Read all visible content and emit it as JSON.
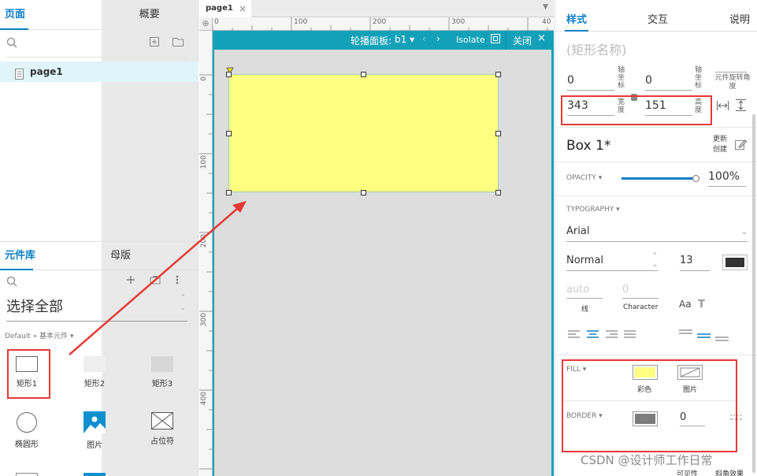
{
  "left": {
    "tabs": [
      "页面",
      "概要"
    ],
    "page": "page1",
    "lib_tabs": [
      "元件库",
      "母版"
    ],
    "select_all": "选择全部",
    "breadcrumb": "Default » 基本元件 ▾",
    "items": [
      {
        "label": "矩形1",
        "icon": "rect-outline-icon"
      },
      {
        "label": "矩形2",
        "icon": "rect-light-icon"
      },
      {
        "label": "矩形3",
        "icon": "rect-gray-icon"
      },
      {
        "label": "椭圆形",
        "icon": "ellipse-icon"
      },
      {
        "label": "图片",
        "icon": "image-icon"
      },
      {
        "label": "占位符",
        "icon": "placeholder-icon"
      }
    ]
  },
  "center": {
    "doc_tab": "page1",
    "ruler_h": [
      "0",
      "100",
      "200",
      "300",
      "40"
    ],
    "ruler_v": [
      "0",
      "100",
      "200",
      "300",
      "400"
    ],
    "dynamic_panel": {
      "label": "轮播面板:",
      "state": "b1 ▾",
      "isolate": "Isolate",
      "close": "关闭"
    }
  },
  "right": {
    "tabs": [
      "样式",
      "交互",
      "说明"
    ],
    "name_placeholder": "(矩形名称)",
    "x": "0",
    "y": "0",
    "x_label": "轴坐标",
    "y_label": "轴坐标",
    "rotation_label": "元件旋转角度",
    "width": "343",
    "height": "151",
    "width_label": "宽度",
    "height_label": "高度",
    "style_name": "Box 1*",
    "update_create": [
      "更新",
      "创建"
    ],
    "opacity_label": "OPACITY ▾",
    "opacity": "100%",
    "typography_label": "TYPOGRAPHY ▾",
    "font": "Arial",
    "weight": "Normal",
    "size": "13",
    "line_placeholder": "auto",
    "line_label": "线",
    "char_value": "0",
    "char_label": "Character",
    "fill_label": "FILL ▾",
    "fill_color_label": "彩色",
    "fill_image_label": "图片",
    "border_label": "BORDER ▾",
    "border_width": "0",
    "bottom_partial": [
      "可见性",
      "斜角效果"
    ],
    "colors": {
      "fill": "#ffff80",
      "border": "#7d7d7d",
      "text": "#333333",
      "accent": "#0b7fc4",
      "panel": "#13a1b8"
    }
  },
  "watermark": "CSDN @设计师工作日常"
}
